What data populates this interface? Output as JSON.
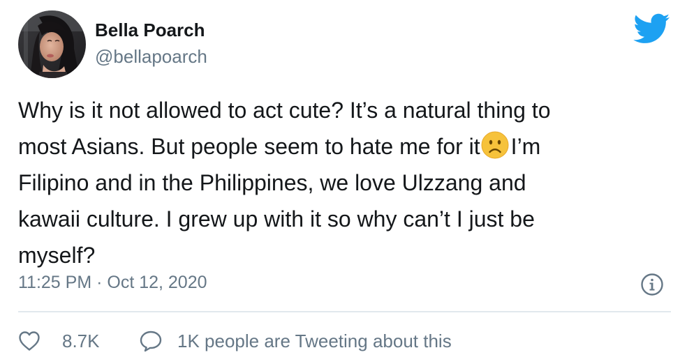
{
  "colors": {
    "text_primary": "#14171a",
    "text_secondary": "#657786",
    "twitter_blue": "#1da1f2",
    "divider": "#e1e8ed",
    "emoji_yellow": "#f6c23b"
  },
  "author": {
    "display_name": "Bella Poarch",
    "handle": "@bellapoarch",
    "avatar_icon": "profile-photo"
  },
  "brand": {
    "icon": "twitter-bird-icon"
  },
  "tweet": {
    "lines": [
      "Why is it not allowed to act cute? It’s a natural thing to",
      "most Asians. But people seem to hate me for it",
      "I’m",
      "Filipino and in the Philippines, we love Ulzzang and",
      "kawaii culture. I grew up with it so why can’t I just be",
      "myself?"
    ],
    "emoji": "slightly-frowning-face"
  },
  "meta": {
    "timestamp": "11:25 PM · Oct 12, 2020",
    "info_icon": "info-icon"
  },
  "actions": {
    "like_icon": "heart-icon",
    "like_count": "8.7K",
    "reply_icon": "speech-bubble-icon",
    "reply_label": "1K people are Tweeting about this"
  }
}
